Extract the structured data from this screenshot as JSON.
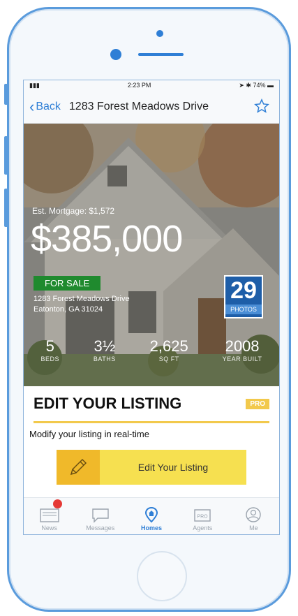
{
  "statusbar": {
    "time": "2:23 PM",
    "battery": "74%"
  },
  "navbar": {
    "back_label": "Back",
    "title": "1283 Forest Meadows Drive",
    "favorite_icon": "star-icon"
  },
  "listing": {
    "mortgage": "Est. Mortgage: $1,572",
    "price": "$385,000",
    "status_badge": "FOR SALE",
    "address_line1": "1283 Forest Meadows Drive",
    "address_line2": "Eatonton, GA 31024",
    "photos_count": "29",
    "photos_label": "PHOTOS",
    "stats": [
      {
        "value": "5",
        "label": "BEDS"
      },
      {
        "value": "3½",
        "label": "BATHS"
      },
      {
        "value": "2,625",
        "label": "SQ FT"
      },
      {
        "value": "2008",
        "label": "YEAR BUILT"
      }
    ]
  },
  "edit": {
    "title": "EDIT YOUR LISTING",
    "pro_badge": "PRO",
    "subtitle": "Modify your listing in real-time",
    "button_label": "Edit Your Listing"
  },
  "tabbar": {
    "items": [
      {
        "label": "News",
        "icon": "news-icon"
      },
      {
        "label": "Messages",
        "icon": "messages-icon"
      },
      {
        "label": "Homes",
        "icon": "homes-icon"
      },
      {
        "label": "Agents",
        "icon": "agents-icon"
      },
      {
        "label": "Me",
        "icon": "profile-icon"
      }
    ],
    "active": "Homes",
    "pro_icon_text": "PRO"
  },
  "colors": {
    "accent": "#2f7fd6",
    "pro": "#f2c94c",
    "sale": "#1f8a2e",
    "button": "#f6e050"
  }
}
